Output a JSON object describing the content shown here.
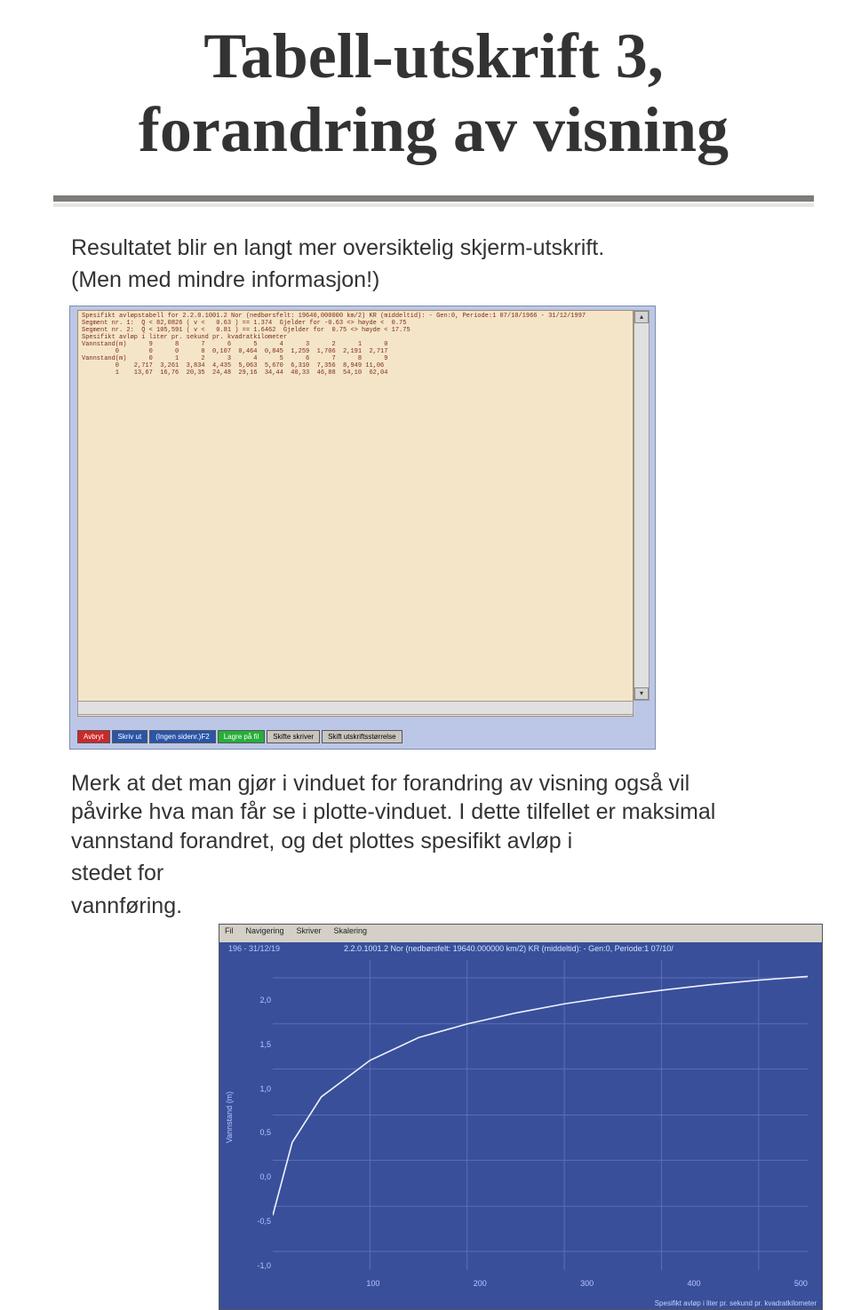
{
  "title": "Tabell-utskrift 3, forandring av visning",
  "para1_line1": "Resultatet blir en langt mer oversiktelig skjerm-utskrift.",
  "para1_line2": "(Men med mindre informasjon!)",
  "para2": "Merk at det man gjør i vinduet for forandring av visning også vil påvirke hva man får se i plotte-vinduet. I dette tilfellet er maksimal vannstand forandret, og det plottes spesifikt avløp i",
  "para2_tail1": "stedet for",
  "para2_tail2": "vannføring.",
  "shot1": {
    "header": "Spesifikt avløpstabell for 2.2.0.1001.2 Nor (nedbørsfelt: 19640,000000 km/2) KR (middeltid): - Gen:0, Periode:1 07/10/1966 - 31/12/1997",
    "seg1": "Segment nr. 1:  Q < 82,0826 ( v <   0.63 ) == 1.374  Gjelder for -0.63 <> høyde <  0.75",
    "seg2": "Segment nr. 2:  Q < 105,591 ( v <   0.81 ) == 1.6462  Gjelder for  0.75 <> høyde < 17.75",
    "row_h1": "Spesifikt avløp i liter pr. sekund pr. kvadratkilometer",
    "row_h2": "Vannstand(m)      9      8      7      6      5      4      3      2      1      0",
    "data1": "         0        0      0      0  0,107  0,464  0,845  1,259  1,706  2,191  2,717",
    "data2": "Vannstand(m)      0      1      2      3      4      5      6      7      8      9",
    "data3": "         0    2,717  3,261  3,834  4,435  5,063  5,670  6,310  7,356  8,949 11,06",
    "data4": "         1    13,67  16,76  20,35  24,48  29,16  34,44  40,33  46,88  54,10  62,04",
    "buttons": [
      {
        "label": "Avbryt",
        "class": "red"
      },
      {
        "label": "Skriv ut",
        "class": "blue"
      },
      {
        "label": "(Ingen sidenr.)F2",
        "class": "blue"
      },
      {
        "label": "Lagre på fil",
        "class": "green"
      },
      {
        "label": "Skifte skriver",
        "class": "gray"
      },
      {
        "label": "Skift utskriftsstørrelse",
        "class": "gray"
      }
    ]
  },
  "shot2": {
    "menu": [
      "Fil",
      "Navigering",
      "Skriver",
      "Skalering"
    ],
    "sub": "196 - 31/12/19",
    "header": "2.2.0.1001.2 Nor  (nedbørsfelt: 19640.000000 km/2) KR (middeltid): - Gen:0, Periode:1 07/10/",
    "ylabel": "Vannstand (m)",
    "xticks": [
      "",
      "100",
      "200",
      "300",
      "400",
      "500"
    ],
    "yticks": [
      "",
      "2,0",
      "1,5",
      "1,0",
      "0,5",
      "0,0",
      "-0,5",
      "-1,0"
    ],
    "footer": "Spesifikt avløp i liter pr. sekund pr. kvadratkilometer"
  },
  "chart_data": {
    "type": "line",
    "title": "2.2.0.1001.2 Nor (nedbørsfelt: 19640 km²) KR (middeltid) - Gen:0, Periode:1",
    "xlabel": "Spesifikt avløp i liter pr. sekund pr. kvadratkilometer",
    "ylabel": "Vannstand (m)",
    "xlim": [
      0,
      550
    ],
    "ylim": [
      -1.2,
      2.2
    ],
    "x": [
      0,
      20,
      50,
      100,
      150,
      200,
      250,
      300,
      350,
      400,
      450,
      500,
      550
    ],
    "y": [
      -0.6,
      0.2,
      0.7,
      1.1,
      1.35,
      1.5,
      1.62,
      1.72,
      1.8,
      1.87,
      1.93,
      1.98,
      2.02
    ]
  }
}
